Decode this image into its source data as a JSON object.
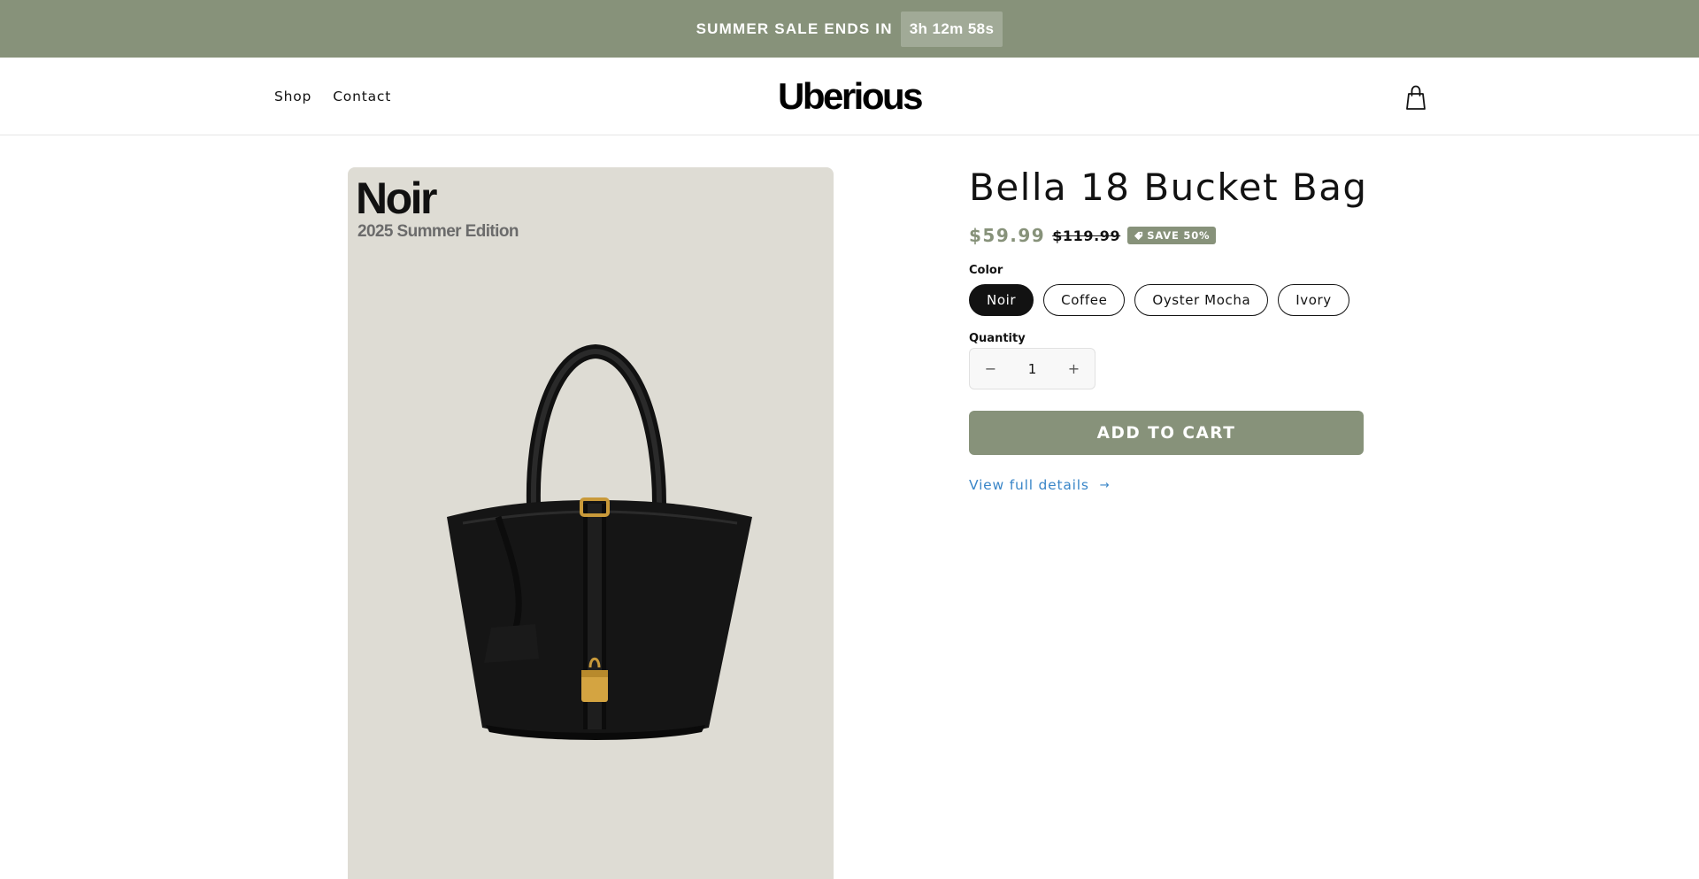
{
  "announcement": {
    "text": "SUMMER SALE ENDS IN",
    "countdown": "3h 12m 58s"
  },
  "header": {
    "nav": [
      "Shop",
      "Contact"
    ],
    "logo": "Uberious",
    "cart_icon": "shopping-bag-icon"
  },
  "media": {
    "title": "Noir",
    "subtitle": "2025 Summer Edition"
  },
  "product": {
    "title": "Bella 18 Bucket Bag",
    "price": "$59.99",
    "compare_price": "$119.99",
    "badge": "SAVE 50%",
    "color_label": "Color",
    "colors": [
      "Noir",
      "Coffee",
      "Oyster Mocha",
      "Ivory"
    ],
    "selected_color": "Noir",
    "quantity_label": "Quantity",
    "quantity": "1",
    "minus": "−",
    "plus": "+",
    "add_to_cart": "ADD TO CART",
    "view_details": "View full details",
    "view_details_arrow": "→"
  },
  "colors": {
    "accent": "#87927a",
    "link": "#3a86c8",
    "text": "#121212",
    "media_bg": "#dedcd4"
  }
}
